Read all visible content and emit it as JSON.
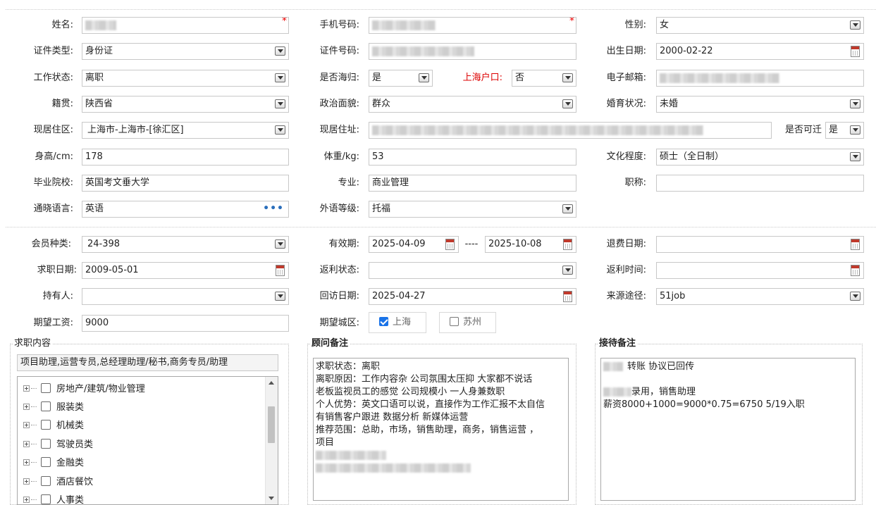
{
  "row1": {
    "name_label": "姓名:",
    "phone_label": "手机号码:",
    "gender_label": "性别:",
    "gender_value": "女",
    "required_mark": "*"
  },
  "row2": {
    "id_type_label": "证件类型:",
    "id_type_value": "身份证",
    "id_no_label": "证件号码:",
    "birth_label": "出生日期:",
    "birth_value": "2000-02-22"
  },
  "row3": {
    "work_status_label": "工作状态:",
    "work_status_value": "离职",
    "overseas_label": "是否海归:",
    "overseas_value": "是",
    "hukou_label": "上海户口:",
    "hukou_value": "否",
    "email_label": "电子邮箱:"
  },
  "row4": {
    "native_label": "籍贯:",
    "native_value": "陕西省",
    "political_label": "政治面貌:",
    "political_value": "群众",
    "marital_label": "婚育状况:",
    "marital_value": "未婚"
  },
  "row5": {
    "residence_label": "现居住区:",
    "residence_value": "上海市-上海市-[徐汇区]",
    "address_label": "现居住址:",
    "relocate_label": "是否可迁",
    "relocate_value": "是"
  },
  "row6": {
    "height_label": "身高/cm:",
    "height_value": "178",
    "weight_label": "体重/kg:",
    "weight_value": "53",
    "education_label": "文化程度:",
    "education_value": "硕士（全日制）"
  },
  "row7": {
    "school_label": "毕业院校:",
    "school_value": "英国考文垂大学",
    "major_label": "专业:",
    "major_value": "商业管理",
    "title_label": "职称:"
  },
  "row8": {
    "language_label": "通晓语言:",
    "language_value": "英语",
    "language_level_label": "外语等级:",
    "language_level_value": "托福"
  },
  "row9": {
    "member_type_label": "会员种类:",
    "member_type_value": "24-398",
    "valid_label": "有效期:",
    "valid_from": "2025-04-09",
    "valid_sep": "----",
    "valid_to": "2025-10-08",
    "refund_date_label": "退费日期:"
  },
  "row10": {
    "job_date_label": "求职日期:",
    "job_date_value": "2009-05-01",
    "rebate_status_label": "返利状态:",
    "rebate_time_label": "返利时间:"
  },
  "row11": {
    "holder_label": "持有人:",
    "revisit_label": "回访日期:",
    "revisit_value": "2025-04-27",
    "source_label": "来源途径:",
    "source_value": "51job"
  },
  "row12": {
    "salary_label": "期望工资:",
    "salary_value": "9000",
    "city_label": "期望城区:",
    "city_shanghai": "上海",
    "city_suzhou": "苏州",
    "shanghai_checked": true,
    "suzhou_checked": false
  },
  "job_panel": {
    "title": "求职内容",
    "summary": "项目助理,运营专员,总经理助理/秘书,商务专员/助理",
    "categories": [
      "房地产/建筑/物业管理",
      "服装类",
      "机械类",
      "驾驶员类",
      "金融类",
      "酒店餐饮",
      "人事类"
    ]
  },
  "consultant_panel": {
    "title": "顾问备注",
    "lines": [
      "求职状态：离职",
      "离职原因：工作内容杂  公司氛围太压抑 大家都不说话",
      "老板监视员工的感觉  公司规模小 一人身兼数职",
      "个人优势：英文口语可以说，直接作为工作汇报不太自信",
      "有销售客户跟进 数据分析 新媒体运营",
      "推荐范围：总助，市场，销售助理，商务，销售运营 ，",
      "项目"
    ]
  },
  "reception_panel": {
    "title": "接待备注",
    "line1": "转账 协议已回传",
    "line2": "录用，销售助理",
    "line3": "薪资8000+1000=9000*0.75=6750    5/19入职"
  }
}
